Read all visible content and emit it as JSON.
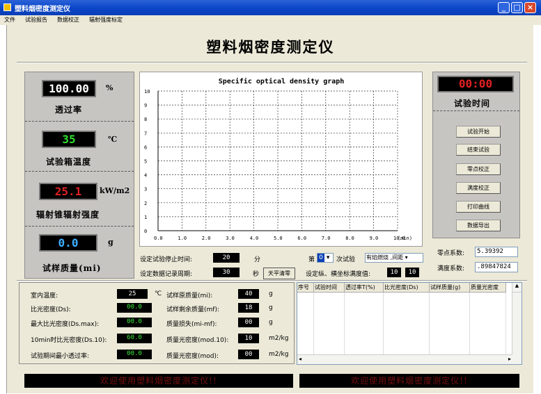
{
  "window": {
    "title": "塑料烟密度测定仪",
    "minimize": "_",
    "maximize": "□",
    "close": "×"
  },
  "menu": [
    "文件",
    "试验报告",
    "数据校正",
    "辐射强度标定"
  ],
  "app_title": "塑料烟密度测定仪",
  "left": {
    "transmittance": {
      "value": "100.00",
      "unit": "%",
      "label": "透过率"
    },
    "chamber_temp": {
      "value": "35",
      "unit": "℃",
      "label": "试验箱温度"
    },
    "radiant_intensity": {
      "value": "25.1",
      "unit": "kW/m2",
      "label": "辐射锥辐射强度"
    },
    "sample_mass": {
      "value": "0.0",
      "unit": "g",
      "label": "试样质量(mi)"
    }
  },
  "chart_data": {
    "type": "line",
    "title": "Specific optical density graph",
    "x_unit": "(min)",
    "xlim": [
      0,
      10
    ],
    "ylim": [
      0,
      10
    ],
    "x_ticks": [
      "0.0",
      "1.0",
      "2.0",
      "3.0",
      "4.0",
      "5.0",
      "6.0",
      "7.0",
      "8.0",
      "9.0",
      "10.0"
    ],
    "y_ticks": [
      "0",
      "1",
      "2",
      "3",
      "4",
      "5",
      "6",
      "7",
      "8",
      "9",
      "10"
    ],
    "grid": true,
    "series": []
  },
  "settings": {
    "stop_time_label": "设定试验停止时间:",
    "stop_time_value": "20",
    "stop_time_unit": "分",
    "record_period_label": "设定数据记录周期:",
    "record_period_value": "30",
    "record_period_unit": "秒",
    "balance_button": "天平清零",
    "run_prefix": "第",
    "run_number": "0",
    "run_suffix": "次试验",
    "mode_value": "有焰燃烧 ,间距 ▾",
    "axis_label": "设定纵、横坐标满度值:",
    "axis_y": "10",
    "axis_x": "10"
  },
  "right": {
    "timer": "00:00",
    "timer_label": "试验时间",
    "buttons": [
      "试验开始",
      "结束试验",
      "零点校正",
      "满度校正",
      "打印曲线",
      "数据导出"
    ],
    "zero_coef_label": "零点系数:",
    "zero_coef_value": "5.39392",
    "full_coef_label": "满度系数:",
    "full_coef_value": ".89847824"
  },
  "bottom": {
    "room_temp": {
      "label": "室内温度:",
      "value": "25",
      "unit": "℃"
    },
    "specific_density": {
      "label": "比光密度(Ds):",
      "value": "00.0"
    },
    "max_density": {
      "label": "最大比光密度(Ds.max):",
      "value": "00.0"
    },
    "density_10": {
      "label": "10min时比光密度(Ds.10):",
      "value": "60.0"
    },
    "min_transmittance": {
      "label": "试验期间最小透过率:",
      "value": "00.0"
    },
    "initial_mass": {
      "label": "试样原质量(mi):",
      "value": "40",
      "unit": "g"
    },
    "residual_mass": {
      "label": "试样剩余质量(mf):",
      "value": "18",
      "unit": "g"
    },
    "mass_loss": {
      "label": "质量损失(mi-mf):",
      "value": "00",
      "unit": "g"
    },
    "mass_density_10": {
      "label": "质量光密度(mod.10):",
      "value": "10",
      "unit": "m2/kg"
    },
    "mass_density": {
      "label": "质量光密度(mod):",
      "value": "00",
      "unit": "m2/kg"
    }
  },
  "table": {
    "headers": [
      "序号",
      "试验时间",
      "透过率T(%)",
      "比光密度(Ds)",
      "试样质量(g)",
      "质量光密度"
    ]
  },
  "status": {
    "left": "欢迎使用塑料烟密度测定仪!!",
    "right": "欢迎使用塑料烟密度测定仪!!"
  }
}
